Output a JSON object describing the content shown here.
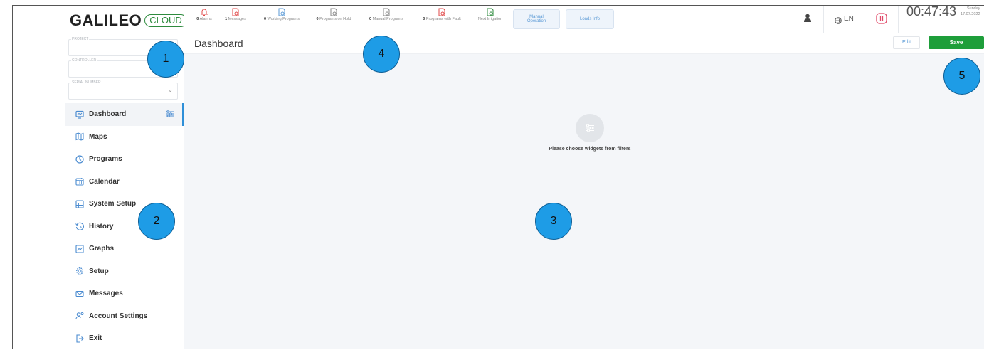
{
  "brand": {
    "name": "GALILEO",
    "cloud": "CLOUD",
    "collapse": "«"
  },
  "fields": {
    "project_label": "PROJECT",
    "controller_label": "CONTROLLER",
    "serial_label": "SERIAL NUMBER"
  },
  "sidebar": {
    "items": [
      {
        "label": "Dashboard",
        "icon": "monitor-icon",
        "active": true
      },
      {
        "label": "Maps",
        "icon": "map-icon"
      },
      {
        "label": "Programs",
        "icon": "clock-icon"
      },
      {
        "label": "Calendar",
        "icon": "calendar-icon"
      },
      {
        "label": "System Setup",
        "icon": "table-icon"
      },
      {
        "label": "History",
        "icon": "history-icon"
      },
      {
        "label": "Graphs",
        "icon": "graph-icon"
      },
      {
        "label": "Setup",
        "icon": "gear-icon"
      },
      {
        "label": "Messages",
        "icon": "envelope-icon"
      },
      {
        "label": "Account Settings",
        "icon": "user-gear-icon"
      },
      {
        "label": "Exit",
        "icon": "exit-icon"
      }
    ]
  },
  "topbar": {
    "stats": [
      {
        "count": "0",
        "label": "Alarms",
        "color": "#e04848"
      },
      {
        "count": "1",
        "label": "Messages",
        "color": "#e04848"
      },
      {
        "count": "0",
        "label": "Working Programs",
        "color": "#5b9ad6"
      },
      {
        "count": "0",
        "label": "Programs on Hold",
        "color": "#888888"
      },
      {
        "count": "0",
        "label": "Manual Programs",
        "color": "#888888"
      },
      {
        "count": "0",
        "label": "Programs with Fault",
        "color": "#e04848"
      },
      {
        "count": "",
        "label": "Next Irrigation",
        "color": "#2e8b3e"
      }
    ],
    "manual_line1": "Manual",
    "manual_line2": "Operation",
    "loads_info": "Loads Info",
    "language": "EN",
    "clock": "00:47:43",
    "day": "Sunday",
    "date": "17.07.2022"
  },
  "header": {
    "title": "Dashboard",
    "edit": "Edit",
    "save": "Save"
  },
  "content": {
    "empty_message": "Please choose widgets from filters"
  },
  "badges": [
    "1",
    "2",
    "3",
    "4",
    "5"
  ],
  "colors": {
    "accent": "#2e8fd8",
    "save": "#1e9e3a",
    "badge": "#1e9ce6",
    "alarm": "#e04848"
  }
}
